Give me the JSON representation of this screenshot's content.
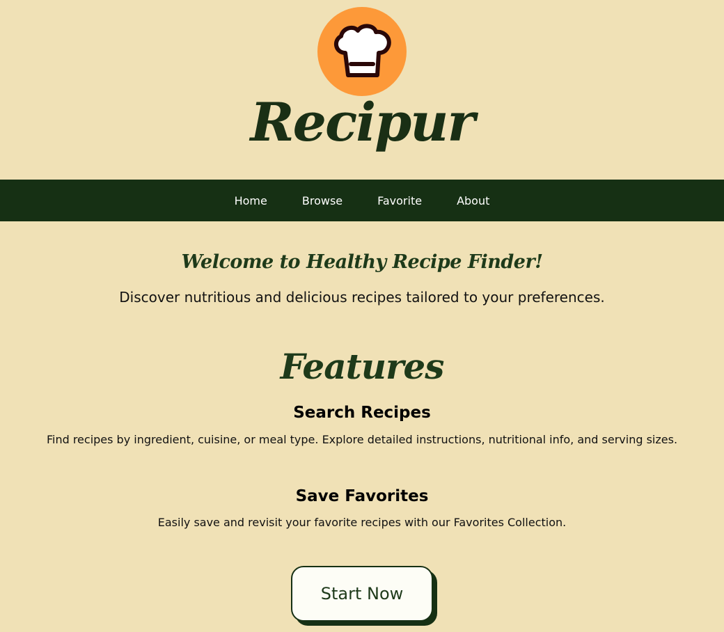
{
  "brand": {
    "name": "Recipur",
    "logo_icon": "chef-hat-icon",
    "logo_bg_color": "#fd9939"
  },
  "nav": {
    "items": [
      {
        "label": "Home"
      },
      {
        "label": "Browse"
      },
      {
        "label": "Favorite"
      },
      {
        "label": "About"
      }
    ]
  },
  "hero": {
    "title": "Welcome to Healthy Recipe Finder!",
    "subtitle": "Discover nutritious and delicious recipes tailored to your preferences."
  },
  "features": {
    "title": "Features",
    "items": [
      {
        "heading": "Search Recipes",
        "text": "Find recipes by ingredient, cuisine, or meal type. Explore detailed instructions, nutritional info, and serving sizes."
      },
      {
        "heading": "Save Favorites",
        "text": "Easily save and revisit your favorite recipes with our Favorites Collection."
      }
    ]
  },
  "cta": {
    "label": "Start Now"
  },
  "colors": {
    "background": "#f0e1b6",
    "nav_background": "#163014",
    "accent_dark_green": "#1e3a1a",
    "logo_orange": "#fd9939"
  }
}
